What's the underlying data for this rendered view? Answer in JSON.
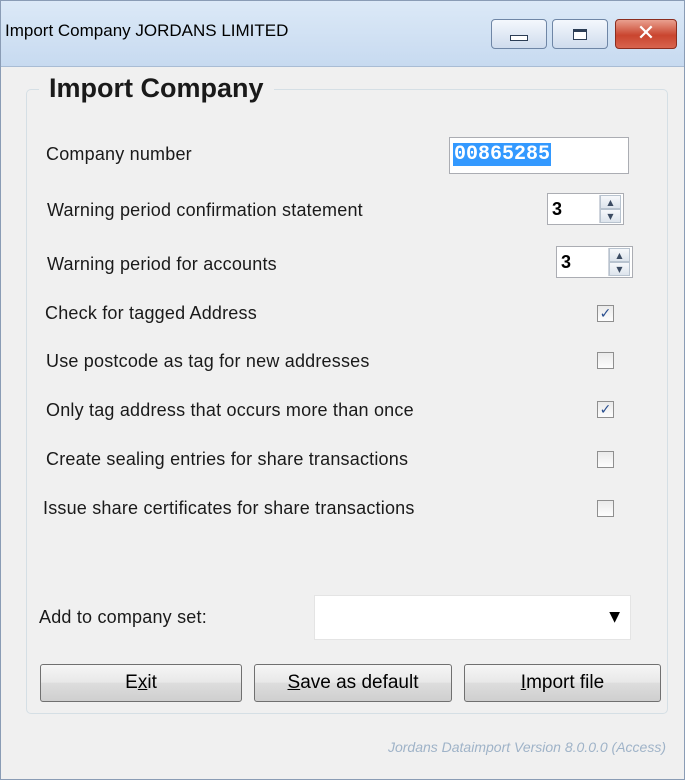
{
  "window": {
    "title": "Import Company JORDANS LIMITED"
  },
  "group": {
    "title": "Import Company"
  },
  "company_number": {
    "label": "Company number",
    "value": "00865285"
  },
  "warning_confirmation": {
    "label": "Warning period confirmation statement",
    "value": "3"
  },
  "warning_accounts": {
    "label": "Warning period for accounts",
    "value": "3"
  },
  "options": [
    {
      "label": "Check for tagged Address",
      "checked": true
    },
    {
      "label": "Use postcode as tag for new addresses",
      "checked": false
    },
    {
      "label": "Only tag address that occurs more than once",
      "checked": true
    },
    {
      "label": "Create sealing entries for share transactions",
      "checked": false
    },
    {
      "label": "Issue share certificates for share transactions",
      "checked": false
    }
  ],
  "company_set": {
    "label": "Add to company set:",
    "value": ""
  },
  "buttons": {
    "exit": {
      "pre": "E",
      "accel": "x",
      "post": "it"
    },
    "save_default": {
      "pre": "",
      "accel": "S",
      "post": "ave as default"
    },
    "import_file": {
      "pre": "",
      "accel": "I",
      "post": "mport file"
    }
  },
  "footer": "Jordans Dataimport Version 8.0.0.0 (Access)"
}
